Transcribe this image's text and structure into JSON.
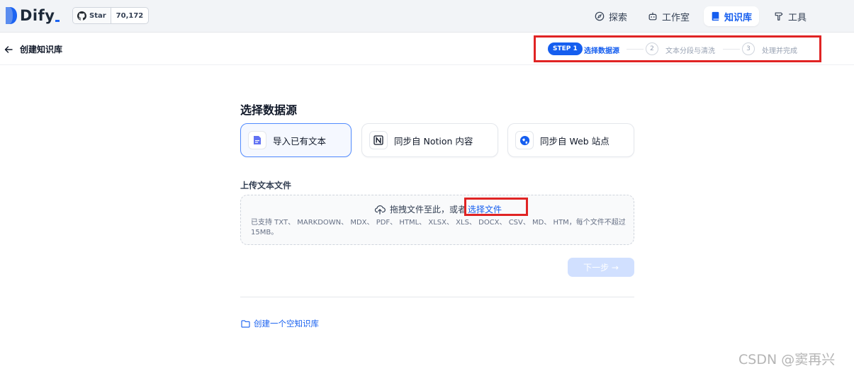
{
  "brand": {
    "name": "Dify",
    "accent": "#155eef"
  },
  "github": {
    "star_label": "Star",
    "count": "70,172"
  },
  "nav": [
    {
      "label": "探索",
      "icon": "compass-icon"
    },
    {
      "label": "工作室",
      "icon": "robot-icon"
    },
    {
      "label": "知识库",
      "icon": "book-icon",
      "active": true
    },
    {
      "label": "工具",
      "icon": "hammer-icon"
    }
  ],
  "header": {
    "back_label": "创建知识库"
  },
  "steps": [
    {
      "badge": "STEP 1",
      "label": "选择数据源",
      "active": true
    },
    {
      "number": "2",
      "label": "文本分段与清洗"
    },
    {
      "number": "3",
      "label": "处理并完成"
    }
  ],
  "main": {
    "title": "选择数据源",
    "sources": [
      {
        "label": "导入已有文本",
        "icon": "document-icon",
        "active": true
      },
      {
        "label": "同步自 Notion 内容",
        "icon": "notion-icon"
      },
      {
        "label": "同步自 Web 站点",
        "icon": "web-icon"
      }
    ],
    "upload_label": "上传文本文件",
    "drop_text": "拖拽文件至此，或者",
    "choose_file": "选择文件",
    "hint": "已支持 TXT、 MARKDOWN、 MDX、 PDF、 HTML、 XLSX、 XLS、 DOCX、 CSV、 MD、 HTM，每个文件不超过 15MB。",
    "next_label": "下一步 →",
    "create_empty": "创建一个空知识库"
  },
  "watermark": "CSDN @窦再兴",
  "colors": {
    "highlight_box": "#e02424",
    "primary": "#155eef"
  }
}
